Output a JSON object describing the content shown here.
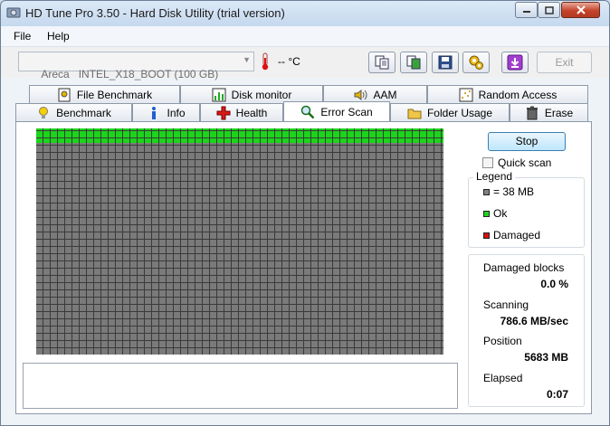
{
  "window": {
    "title": "HD Tune Pro 3.50 - Hard Disk Utility (trial version)"
  },
  "menu": [
    {
      "label": "File"
    },
    {
      "label": "Help"
    }
  ],
  "toolbar": {
    "drive_select": "Areca   INTEL_X18_BOOT (100 GB)",
    "temperature": "-- °C",
    "exit_label": "Exit",
    "buttons": [
      "copy-text-icon",
      "copy-screenshot-icon",
      "save-icon",
      "options-icon",
      "download-icon"
    ]
  },
  "tabs": {
    "row_top": [
      "File Benchmark",
      "Disk monitor",
      "AAM",
      "Random Access"
    ],
    "row_bottom": [
      "Benchmark",
      "Info",
      "Health",
      "Error Scan",
      "Folder Usage",
      "Erase"
    ],
    "active": "Error Scan"
  },
  "scan": {
    "stop_label": "Stop",
    "quick_scan_label": "Quick scan",
    "quick_scan_checked": false,
    "legend_title": "Legend",
    "legend_block": "= 38 MB",
    "legend_ok": "Ok",
    "legend_damaged": "Damaged",
    "colors": {
      "block": "#808080",
      "ok": "#1bd51b",
      "damaged": "#d81010"
    },
    "progress_fraction": 0.06
  },
  "stats": {
    "damaged_label": "Damaged blocks",
    "damaged_value": "0.0 %",
    "scanning_label": "Scanning",
    "scanning_value": "786.6 MB/sec",
    "position_label": "Position",
    "position_value": "5683 MB",
    "elapsed_label": "Elapsed",
    "elapsed_value": "0:07"
  }
}
